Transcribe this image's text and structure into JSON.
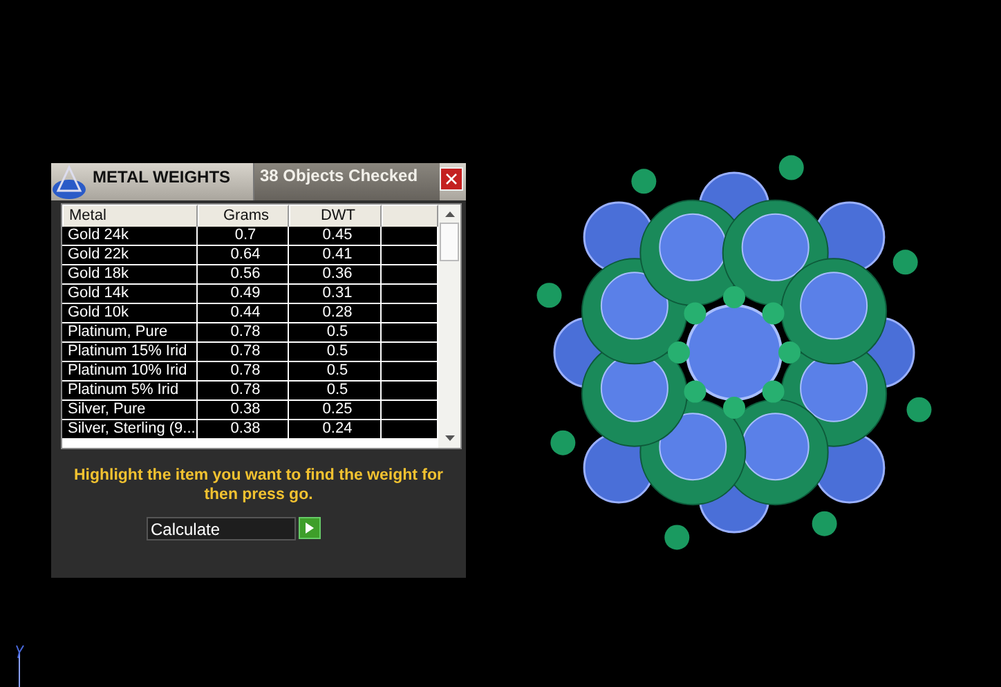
{
  "panel": {
    "title": "METAL WEIGHTS",
    "status": "38 Objects Checked"
  },
  "table": {
    "columns": [
      "Metal",
      "Grams",
      "DWT"
    ],
    "rows": [
      {
        "metal": "Gold 24k",
        "grams": "0.7",
        "dwt": "0.45"
      },
      {
        "metal": "Gold 22k",
        "grams": "0.64",
        "dwt": "0.41"
      },
      {
        "metal": "Gold 18k",
        "grams": "0.56",
        "dwt": "0.36"
      },
      {
        "metal": "Gold 14k",
        "grams": "0.49",
        "dwt": "0.31"
      },
      {
        "metal": "Gold 10k",
        "grams": "0.44",
        "dwt": "0.28"
      },
      {
        "metal": "Platinum, Pure",
        "grams": "0.78",
        "dwt": "0.5"
      },
      {
        "metal": "Platinum 15% Irid",
        "grams": "0.78",
        "dwt": "0.5"
      },
      {
        "metal": "Platinum 10% Irid",
        "grams": "0.78",
        "dwt": "0.5"
      },
      {
        "metal": "Platinum 5% Irid",
        "grams": "0.78",
        "dwt": "0.5"
      },
      {
        "metal": "Silver, Pure",
        "grams": "0.38",
        "dwt": "0.25"
      },
      {
        "metal": "Silver, Sterling (9...",
        "grams": "0.38",
        "dwt": "0.24"
      }
    ]
  },
  "instruction": "Highlight the item you want to find the weight for then press go.",
  "action": {
    "value": "Calculate"
  }
}
